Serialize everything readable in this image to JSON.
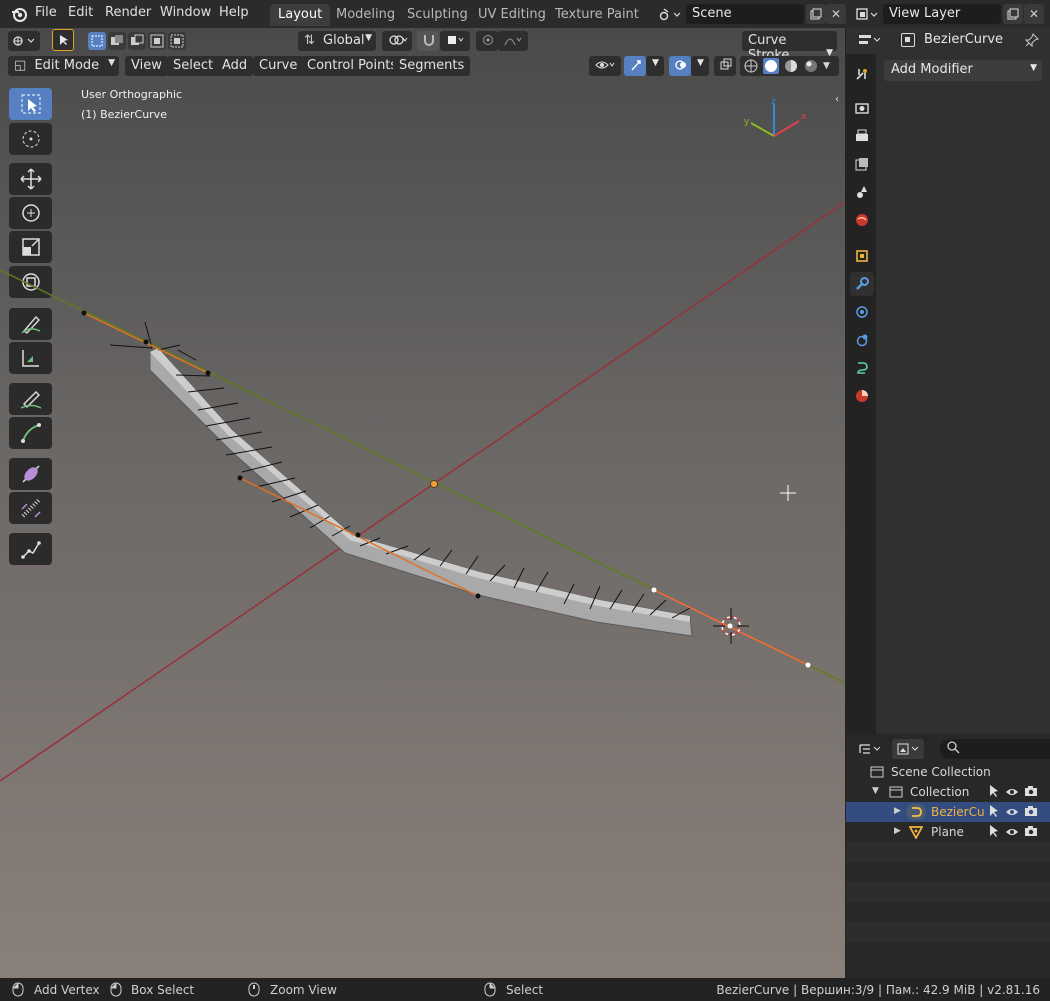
{
  "menu": {
    "items": [
      "File",
      "Edit",
      "Render",
      "Window",
      "Help"
    ]
  },
  "workspaces": [
    "Layout",
    "Modeling",
    "Sculpting",
    "UV Editing",
    "Texture Paint"
  ],
  "scene": {
    "name": "Scene"
  },
  "view_layer": {
    "name": "View Layer"
  },
  "toolbar": {
    "transform_orientation": "Global",
    "curve_stroke": "Curve Stroke"
  },
  "header": {
    "mode": "Edit Mode",
    "menus": [
      "View",
      "Select",
      "Add",
      "Curve",
      "Control Points",
      "Segments"
    ]
  },
  "viewport": {
    "view_name": "User Orthographic",
    "object_label": "(1) BezierCurve",
    "gizmo_axes": [
      "z",
      "y",
      "x"
    ]
  },
  "properties": {
    "object_name": "BezierCurve",
    "add_modifier": "Add Modifier"
  },
  "outliner": {
    "rows": [
      {
        "label": "Scene Collection"
      },
      {
        "label": "Collection"
      },
      {
        "label": "BezierCu"
      },
      {
        "label": "Plane"
      }
    ]
  },
  "statusbar": {
    "add_vertex": "Add Vertex",
    "box_select": "Box Select",
    "zoom_view": "Zoom View",
    "select": "Select",
    "info": "BezierCurve | Вершин:3/9 | Пам.: 42.9 MiB | v2.81.16"
  },
  "colors": {
    "accent": "#5680c2",
    "x_axis": "#a8343f",
    "y_axis": "#6a8a24",
    "handle": "#e0702a",
    "selected_row": "#334d80"
  }
}
